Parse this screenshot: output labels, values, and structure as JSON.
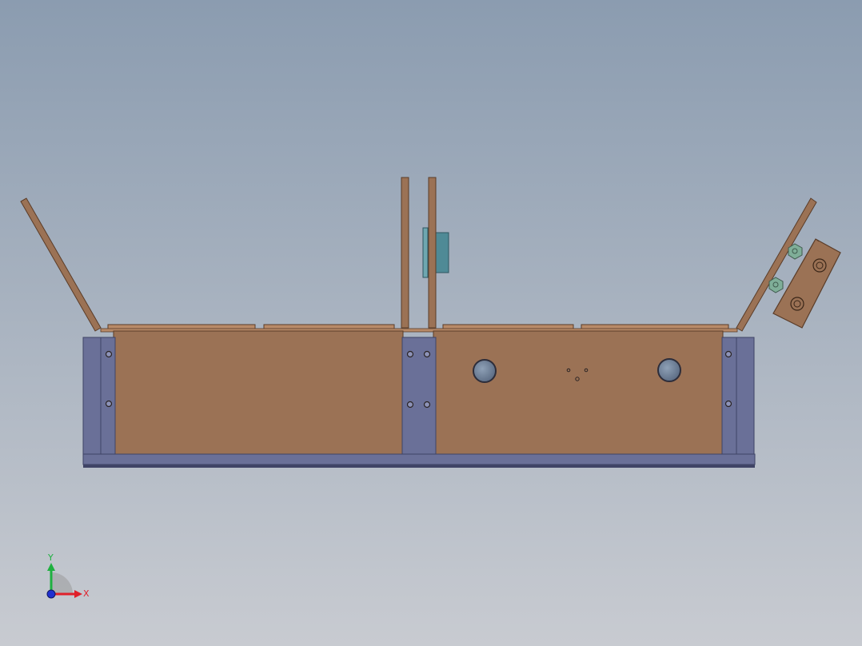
{
  "viewport": {
    "background_top": "#8b9cb0",
    "background_bottom": "#c8cbd1"
  },
  "colors": {
    "wood": "#9b7255",
    "wood_edge": "#5a3c28",
    "wood_top": "#b88a68",
    "steel": "#6a7098",
    "steel_dark": "#3f4466",
    "steel_light": "#8d93b8",
    "hole": "#2a2424",
    "port_fill": "#6c7e96",
    "port_ring": "#2d2d3a",
    "sensor": "#4f8a96",
    "sensor_edge": "#2f5660",
    "fastener": "#7fae98",
    "axis_x": "#e0202a",
    "axis_y": "#1fb040",
    "axis_z": "#2030d0"
  },
  "model": {
    "parts": [
      {
        "name": "left-lid-panel",
        "kind": "wood"
      },
      {
        "name": "right-lid-panel",
        "kind": "wood"
      },
      {
        "name": "center-divider-left",
        "kind": "wood"
      },
      {
        "name": "center-divider-right",
        "kind": "wood"
      },
      {
        "name": "sensor-block",
        "kind": "sensor"
      },
      {
        "name": "hinge-bracket",
        "kind": "wood"
      },
      {
        "name": "front-panel-left",
        "kind": "wood"
      },
      {
        "name": "front-panel-right",
        "kind": "wood"
      },
      {
        "name": "base-rail",
        "kind": "steel"
      },
      {
        "name": "steel-post-left",
        "kind": "steel"
      },
      {
        "name": "steel-post-center",
        "kind": "steel"
      },
      {
        "name": "steel-post-right",
        "kind": "steel"
      }
    ]
  },
  "triad": {
    "x_label": "X",
    "y_label": "Y"
  }
}
